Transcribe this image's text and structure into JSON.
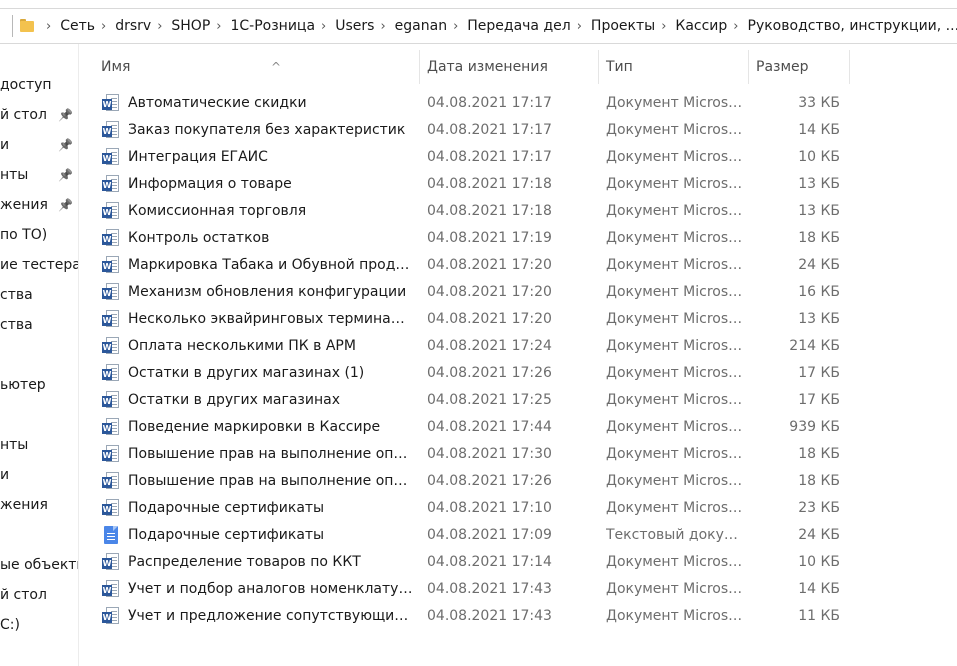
{
  "breadcrumb": [
    "Сеть",
    "drsrv",
    "SHOP",
    "1С-Розница",
    "Users",
    "eganan",
    "Передача дел",
    "Проекты",
    "Кассир",
    "Руководство, инструкции, ..."
  ],
  "nav": [
    {
      "label": "доступ",
      "pinned": false
    },
    {
      "label": "й стол",
      "pinned": true
    },
    {
      "label": "и",
      "pinned": true
    },
    {
      "label": "нты",
      "pinned": true
    },
    {
      "label": "жения",
      "pinned": true
    },
    {
      "label": "по ТО)",
      "pinned": false
    },
    {
      "label": "ие тестерам",
      "pinned": false
    },
    {
      "label": "ства",
      "pinned": false
    },
    {
      "label": "ства",
      "pinned": false
    },
    {
      "label": "",
      "pinned": false
    },
    {
      "label": "ьютер",
      "pinned": false
    },
    {
      "label": "",
      "pinned": false
    },
    {
      "label": "нты",
      "pinned": false
    },
    {
      "label": "и",
      "pinned": false
    },
    {
      "label": "жения",
      "pinned": false
    },
    {
      "label": "",
      "pinned": false
    },
    {
      "label": "ые объекты",
      "pinned": false
    },
    {
      "label": "й стол",
      "pinned": false
    },
    {
      "label": "С:)",
      "pinned": false
    }
  ],
  "columns": {
    "name": "Имя",
    "date": "Дата изменения",
    "type": "Тип",
    "size": "Размер"
  },
  "pin_icon": "pin-icon",
  "files": [
    {
      "name": "Автоматические скидки",
      "date": "04.08.2021 17:17",
      "type": "Документ Microso...",
      "size": "33 КБ",
      "icon": "word"
    },
    {
      "name": "Заказ покупателя без характеристик",
      "date": "04.08.2021 17:17",
      "type": "Документ Microso...",
      "size": "14 КБ",
      "icon": "word"
    },
    {
      "name": "Интеграция ЕГАИС",
      "date": "04.08.2021 17:17",
      "type": "Документ Microso...",
      "size": "10 КБ",
      "icon": "word"
    },
    {
      "name": "Информация о товаре",
      "date": "04.08.2021 17:18",
      "type": "Документ Microso...",
      "size": "13 КБ",
      "icon": "word"
    },
    {
      "name": "Комиссионная торговля",
      "date": "04.08.2021 17:18",
      "type": "Документ Microso...",
      "size": "13 КБ",
      "icon": "word"
    },
    {
      "name": "Контроль остатков",
      "date": "04.08.2021 17:19",
      "type": "Документ Microso...",
      "size": "18 КБ",
      "icon": "word"
    },
    {
      "name": "Маркировка Табака и Обувной продук...",
      "date": "04.08.2021 17:20",
      "type": "Документ Microso...",
      "size": "24 КБ",
      "icon": "word"
    },
    {
      "name": "Механизм обновления конфигурации",
      "date": "04.08.2021 17:20",
      "type": "Документ Microso...",
      "size": "16 КБ",
      "icon": "word"
    },
    {
      "name": "Несколько эквайринговых терминалов",
      "date": "04.08.2021 17:20",
      "type": "Документ Microso...",
      "size": "13 КБ",
      "icon": "word"
    },
    {
      "name": "Оплата несколькими ПК в АРМ",
      "date": "04.08.2021 17:24",
      "type": "Документ Microso...",
      "size": "214 КБ",
      "icon": "word"
    },
    {
      "name": "Остатки в других магазинах (1)",
      "date": "04.08.2021 17:26",
      "type": "Документ Microso...",
      "size": "17 КБ",
      "icon": "word"
    },
    {
      "name": "Остатки в других магазинах",
      "date": "04.08.2021 17:25",
      "type": "Документ Microso...",
      "size": "17 КБ",
      "icon": "word"
    },
    {
      "name": "Поведение маркировки в Кассире",
      "date": "04.08.2021 17:44",
      "type": "Документ Microso...",
      "size": "939 КБ",
      "icon": "word"
    },
    {
      "name": "Повышение прав на выполнение опе...",
      "date": "04.08.2021 17:30",
      "type": "Документ Microso...",
      "size": "18 КБ",
      "icon": "word"
    },
    {
      "name": "Повышение прав на выполнение опе...",
      "date": "04.08.2021 17:26",
      "type": "Документ Microso...",
      "size": "18 КБ",
      "icon": "word"
    },
    {
      "name": "Подарочные сертификаты",
      "date": "04.08.2021 17:10",
      "type": "Документ Microso...",
      "size": "23 КБ",
      "icon": "word"
    },
    {
      "name": "Подарочные сертификаты",
      "date": "04.08.2021 17:09",
      "type": "Текстовый докум...",
      "size": "24 КБ",
      "icon": "text"
    },
    {
      "name": "Распределение товаров по ККТ",
      "date": "04.08.2021 17:14",
      "type": "Документ Microso...",
      "size": "10 КБ",
      "icon": "word"
    },
    {
      "name": "Учет и подбор аналогов номенклатуры",
      "date": "04.08.2021 17:43",
      "type": "Документ Microso...",
      "size": "14 КБ",
      "icon": "word"
    },
    {
      "name": "Учет и предложение сопутствующих то...",
      "date": "04.08.2021 17:43",
      "type": "Документ Microso...",
      "size": "11 КБ",
      "icon": "word"
    }
  ]
}
